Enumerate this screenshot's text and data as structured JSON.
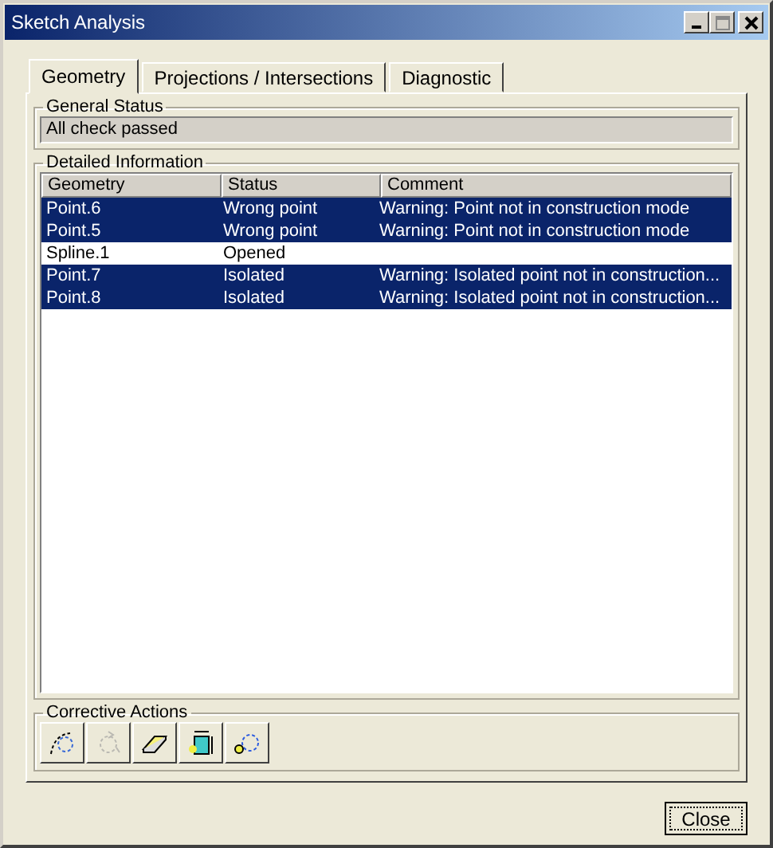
{
  "window": {
    "title": "Sketch Analysis"
  },
  "tabs": [
    {
      "label": "Geometry",
      "selected": true
    },
    {
      "label": "Projections / Intersections",
      "selected": false
    },
    {
      "label": "Diagnostic",
      "selected": false
    }
  ],
  "general_status": {
    "title": "General Status",
    "value": "All check passed"
  },
  "detailed_information": {
    "title": "Detailed Information",
    "columns": [
      "Geometry",
      "Status",
      "Comment"
    ],
    "rows": [
      {
        "cells": [
          "Point.6",
          "Wrong point",
          "Warning: Point not in construction mode"
        ],
        "selected": true
      },
      {
        "cells": [
          "Point.5",
          "Wrong point",
          "Warning: Point not in construction mode"
        ],
        "selected": true
      },
      {
        "cells": [
          "Spline.1",
          "Opened",
          ""
        ],
        "selected": false
      },
      {
        "cells": [
          "Point.7",
          "Isolated",
          "Warning: Isolated point not in construction..."
        ],
        "selected": true
      },
      {
        "cells": [
          "Point.8",
          "Isolated",
          "Warning: Isolated point not in construction..."
        ],
        "selected": true
      }
    ]
  },
  "corrective_actions": {
    "title": "Corrective Actions",
    "buttons": [
      {
        "kind": "arc",
        "disabled": false
      },
      {
        "kind": "rotate",
        "disabled": true
      },
      {
        "kind": "eraser",
        "disabled": false
      },
      {
        "kind": "dimension",
        "disabled": false
      },
      {
        "kind": "construction",
        "disabled": false
      }
    ]
  },
  "buttons": [
    "Close"
  ]
}
